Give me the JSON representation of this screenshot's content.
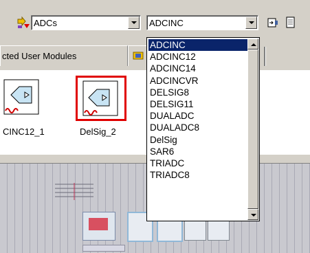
{
  "toolbar": {
    "category_combo": {
      "value": "ADCs"
    },
    "module_combo": {
      "value": "ADCINC"
    }
  },
  "tabs": {
    "selected_modules_label": "cted User Modules"
  },
  "modules": [
    {
      "label": "CINC12_1"
    },
    {
      "label": "DelSig_2"
    }
  ],
  "dropdown": {
    "options": [
      "ADCINC",
      "ADCINC12",
      "ADCINC14",
      "ADCINCVR",
      "DELSIG8",
      "DELSIG11",
      "DUALADC",
      "DUALADC8",
      "DelSig",
      "SAR6",
      "TRIADC",
      "TRIADC8"
    ],
    "selected_index": 0
  },
  "colors": {
    "selection": "#0a246a",
    "module_highlight": "#e00000",
    "chip_background": "#c9c9cf",
    "window_face": "#d4d0c8"
  }
}
